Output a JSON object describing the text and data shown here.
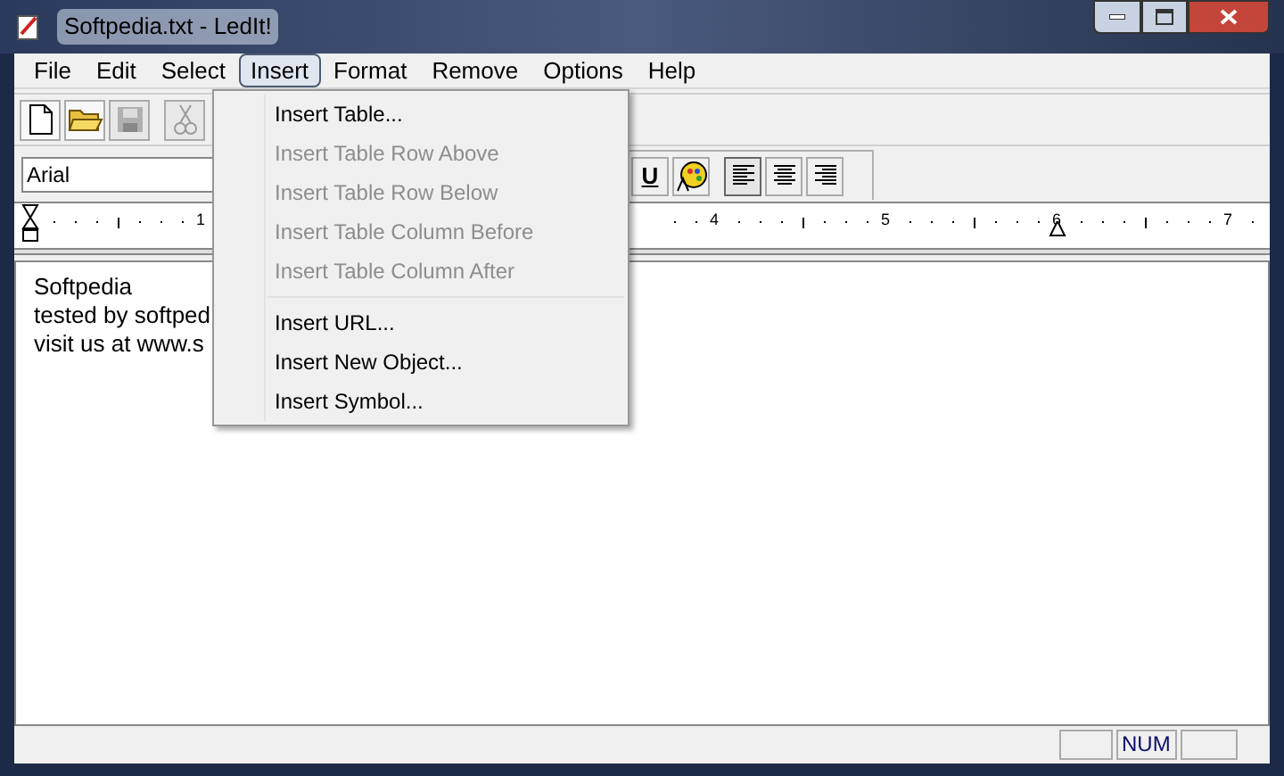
{
  "window": {
    "title": "Softpedia.txt - LedIt!"
  },
  "menu_bar": [
    {
      "label": "File",
      "selected": false
    },
    {
      "label": "Edit",
      "selected": false
    },
    {
      "label": "Select",
      "selected": false
    },
    {
      "label": "Insert",
      "selected": true
    },
    {
      "label": "Format",
      "selected": false
    },
    {
      "label": "Remove",
      "selected": false
    },
    {
      "label": "Options",
      "selected": false
    },
    {
      "label": "Help",
      "selected": false
    }
  ],
  "toolbar": [
    {
      "kind": "new",
      "disabled": false
    },
    {
      "kind": "open",
      "disabled": false
    },
    {
      "kind": "save",
      "disabled": true
    },
    {
      "kind": "cut",
      "disabled": true
    }
  ],
  "format_bar": {
    "font": "Arial",
    "underline": "U",
    "alignments": [
      {
        "kind": "left",
        "selected": true
      },
      {
        "kind": "center",
        "selected": false
      },
      {
        "kind": "right",
        "selected": false
      }
    ]
  },
  "ruler": {
    "labels": [
      "1",
      "4",
      "5",
      "6",
      "7"
    ]
  },
  "document": {
    "lines": [
      "Softpedia",
      "tested by softped",
      "visit us at www.s"
    ]
  },
  "insert_menu": [
    {
      "kind": "item",
      "label": "Insert Table...",
      "disabled": false
    },
    {
      "kind": "item",
      "label": "Insert Table Row Above",
      "disabled": true
    },
    {
      "kind": "item",
      "label": "Insert Table Row Below",
      "disabled": true
    },
    {
      "kind": "item",
      "label": "Insert Table Column Before",
      "disabled": true
    },
    {
      "kind": "item",
      "label": "Insert Table Column After",
      "disabled": true
    },
    {
      "kind": "separator"
    },
    {
      "kind": "item",
      "label": "Insert URL...",
      "disabled": false
    },
    {
      "kind": "item",
      "label": "Insert New Object...",
      "disabled": false
    },
    {
      "kind": "item",
      "label": "Insert Symbol...",
      "disabled": false
    }
  ],
  "status_bar": {
    "num_indicator": "NUM"
  }
}
